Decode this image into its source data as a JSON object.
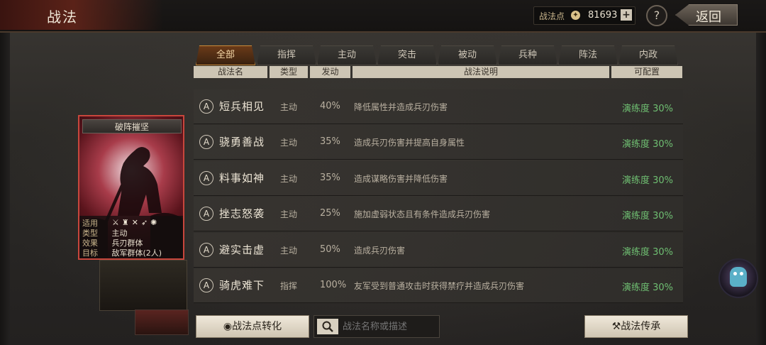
{
  "header": {
    "title": "战法",
    "points_label": "战法点",
    "points_value": "81693",
    "plus_label": "+",
    "help_label": "?",
    "back_label": "返回"
  },
  "tabs": [
    {
      "label": "全部",
      "active": true
    },
    {
      "label": "指挥"
    },
    {
      "label": "主动"
    },
    {
      "label": "突击"
    },
    {
      "label": "被动"
    },
    {
      "label": "兵种"
    },
    {
      "label": "阵法"
    },
    {
      "label": "内政"
    }
  ],
  "columns": [
    "战法名",
    "类型",
    "发动",
    "战法说明",
    "可配置"
  ],
  "skills": [
    {
      "grade": "A",
      "name": "短兵相见",
      "type": "主动",
      "rate": "40%",
      "desc": "降低属性并造成兵刃伤害",
      "proficiency": "演练度 30%"
    },
    {
      "grade": "A",
      "name": "骁勇善战",
      "type": "主动",
      "rate": "35%",
      "desc": "造成兵刃伤害并提高自身属性",
      "proficiency": "演练度 30%"
    },
    {
      "grade": "A",
      "name": "料事如神",
      "type": "主动",
      "rate": "35%",
      "desc": "造成谋略伤害并降低伤害",
      "proficiency": "演练度 30%"
    },
    {
      "grade": "A",
      "name": "挫志怒袭",
      "type": "主动",
      "rate": "25%",
      "desc": "施加虚弱状态且有条件造成兵刃伤害",
      "proficiency": "演练度 30%"
    },
    {
      "grade": "A",
      "name": "避实击虚",
      "type": "主动",
      "rate": "50%",
      "desc": "造成兵刃伤害",
      "proficiency": "演练度 30%"
    },
    {
      "grade": "A",
      "name": "骑虎难下",
      "type": "指挥",
      "rate": "100%",
      "desc": "友军受到普通攻击时获得禁疗并造成兵刃伤害",
      "proficiency": "演练度 30%"
    }
  ],
  "card": {
    "title": "破阵摧坚",
    "suit_label": "适用",
    "suit_icons": "⚔♜✕➶✺",
    "type_label": "类型",
    "type_value": "主动",
    "effect_label": "效果",
    "effect_value": "兵刃群体",
    "target_label": "目标",
    "target_value": "敌军群体(2人)"
  },
  "bottom": {
    "convert_label": "战法点转化",
    "search_placeholder": "战法名称或描述",
    "inherit_label": "战法传承"
  }
}
